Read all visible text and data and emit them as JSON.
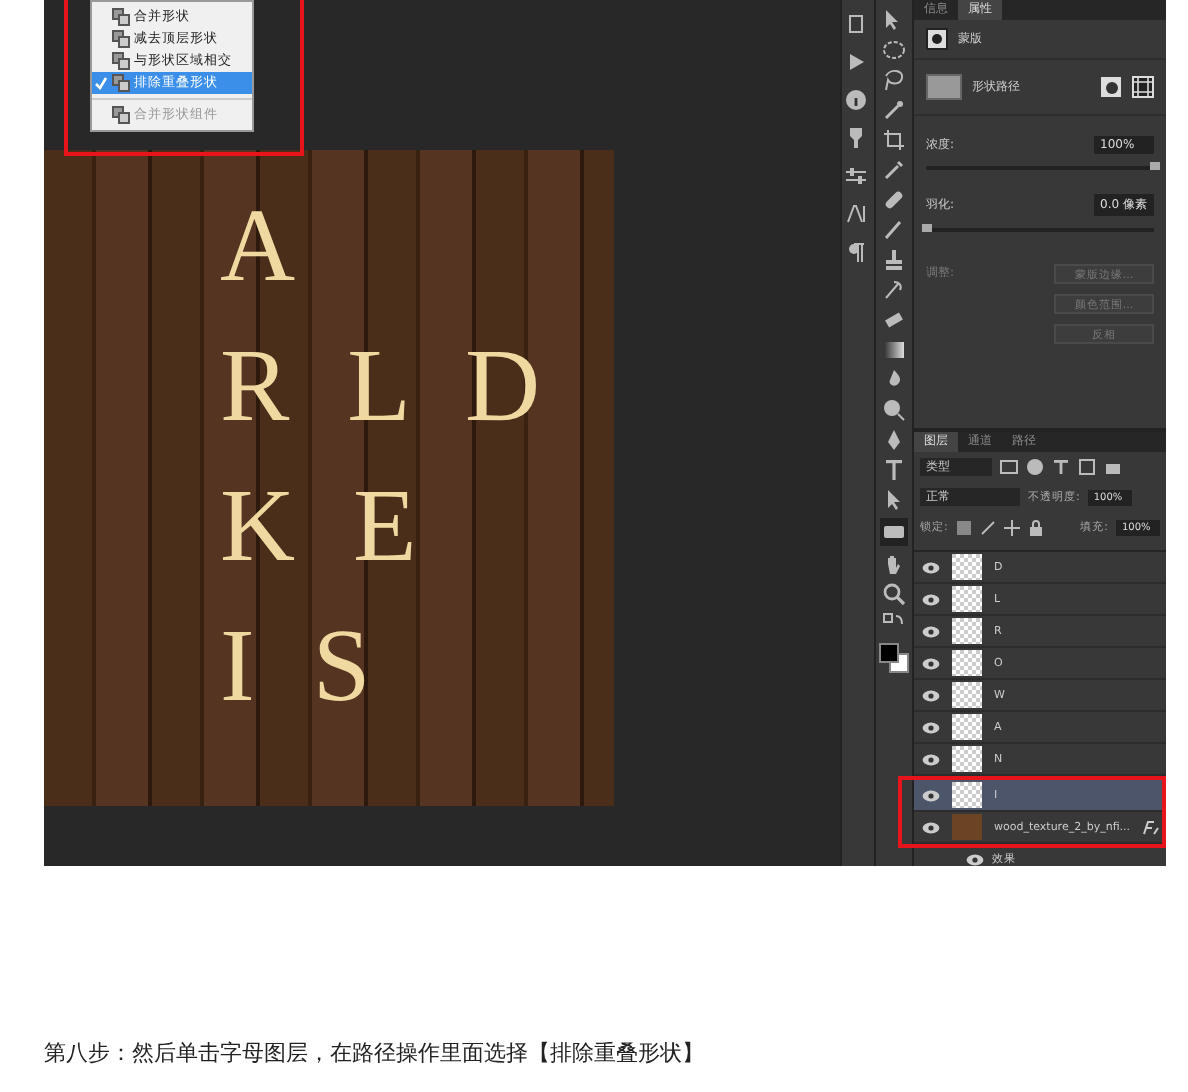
{
  "path_menu": {
    "items": [
      {
        "label": "合并形状",
        "selected": false,
        "disabled": false
      },
      {
        "label": "减去顶层形状",
        "selected": false,
        "disabled": false
      },
      {
        "label": "与形状区域相交",
        "selected": false,
        "disabled": false
      },
      {
        "label": "排除重叠形状",
        "selected": true,
        "disabled": false
      },
      {
        "label": "合并形状组件",
        "selected": false,
        "disabled": true
      }
    ]
  },
  "canvas": {
    "lines": [
      "A",
      "R L D",
      "K E",
      "I S"
    ]
  },
  "properties_panel": {
    "tabs": [
      {
        "label": "信息",
        "selected": false
      },
      {
        "label": "属性",
        "selected": true
      }
    ],
    "header": "蒙版",
    "shape_label": "形状路径",
    "sliders": [
      {
        "label": "浓度:",
        "value": "100%",
        "level": 1
      },
      {
        "label": "羽化:",
        "value": "0.0 像素",
        "level": 0
      }
    ],
    "adjust_label": "调整:",
    "buttons": [
      "蒙版边缘...",
      "颜色范围...",
      "反相"
    ]
  },
  "layers_panel": {
    "tabs": [
      {
        "label": "图层",
        "selected": true
      },
      {
        "label": "通道",
        "selected": false
      },
      {
        "label": "路径",
        "selected": false
      }
    ],
    "filter": "类型",
    "blend_mode": "正常",
    "opacity_label": "不透明度:",
    "opacity": "100%",
    "lock_label": "锁定:",
    "fill_label": "填充:",
    "fill": "100%",
    "layers": [
      {
        "name": "D",
        "kind": "shape",
        "selected": false
      },
      {
        "name": "L",
        "kind": "shape",
        "selected": false
      },
      {
        "name": "R",
        "kind": "shape",
        "selected": false
      },
      {
        "name": "O",
        "kind": "shape",
        "selected": false
      },
      {
        "name": "W",
        "kind": "shape",
        "selected": false
      },
      {
        "name": "A",
        "kind": "shape",
        "selected": false
      },
      {
        "name": "N",
        "kind": "shape",
        "selected": false
      },
      {
        "name": "I",
        "kind": "shape",
        "selected": true
      },
      {
        "name": "wood_texture_2_by_nfi...",
        "kind": "image",
        "selected": false
      }
    ],
    "effects_label": "效果"
  },
  "caption": "第八步：然后单击字母图层，在路径操作里面选择【排除重叠形状】"
}
